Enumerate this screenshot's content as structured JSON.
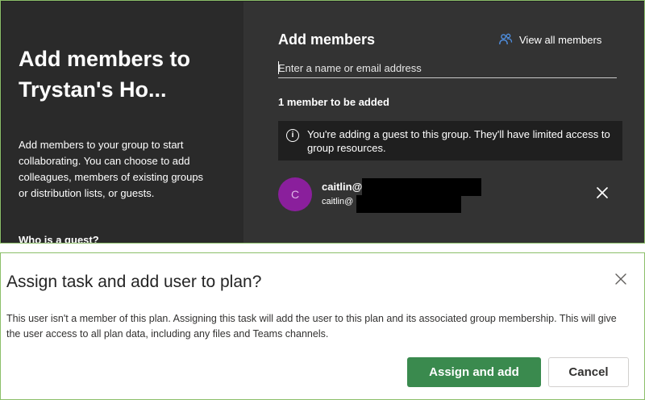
{
  "add_members_panel": {
    "side_title": "Add members to Trystan's Ho...",
    "side_description": "Add members to your group to start collaborating. You can choose to add colleagues, members of existing groups or distribution lists, or guests.",
    "side_link": "Who is a guest?",
    "title": "Add members",
    "view_all_label": "View all members",
    "input_placeholder": "Enter a name or email address",
    "member_count": "1 member to be added",
    "guest_notice": "You're adding a guest to this group. They'll have limited access to group resources.",
    "member": {
      "initial": "C",
      "name": "caitlin@",
      "email": "caitlin@"
    },
    "icons": {
      "view_all": "people-icon",
      "info": "info-icon",
      "remove": "close-icon"
    },
    "colors": {
      "avatar": "#8a1f9c",
      "icon_accent": "#4f8fe0"
    }
  },
  "assign_dialog": {
    "title": "Assign task and add user to plan?",
    "body": "This user isn't a member of this plan. Assigning this task will add the user to this plan and its associated group membership. This will give the user access to all plan data, including any files and Teams channels.",
    "primary_label": "Assign and add",
    "secondary_label": "Cancel",
    "colors": {
      "primary": "#3a8a4e"
    }
  }
}
